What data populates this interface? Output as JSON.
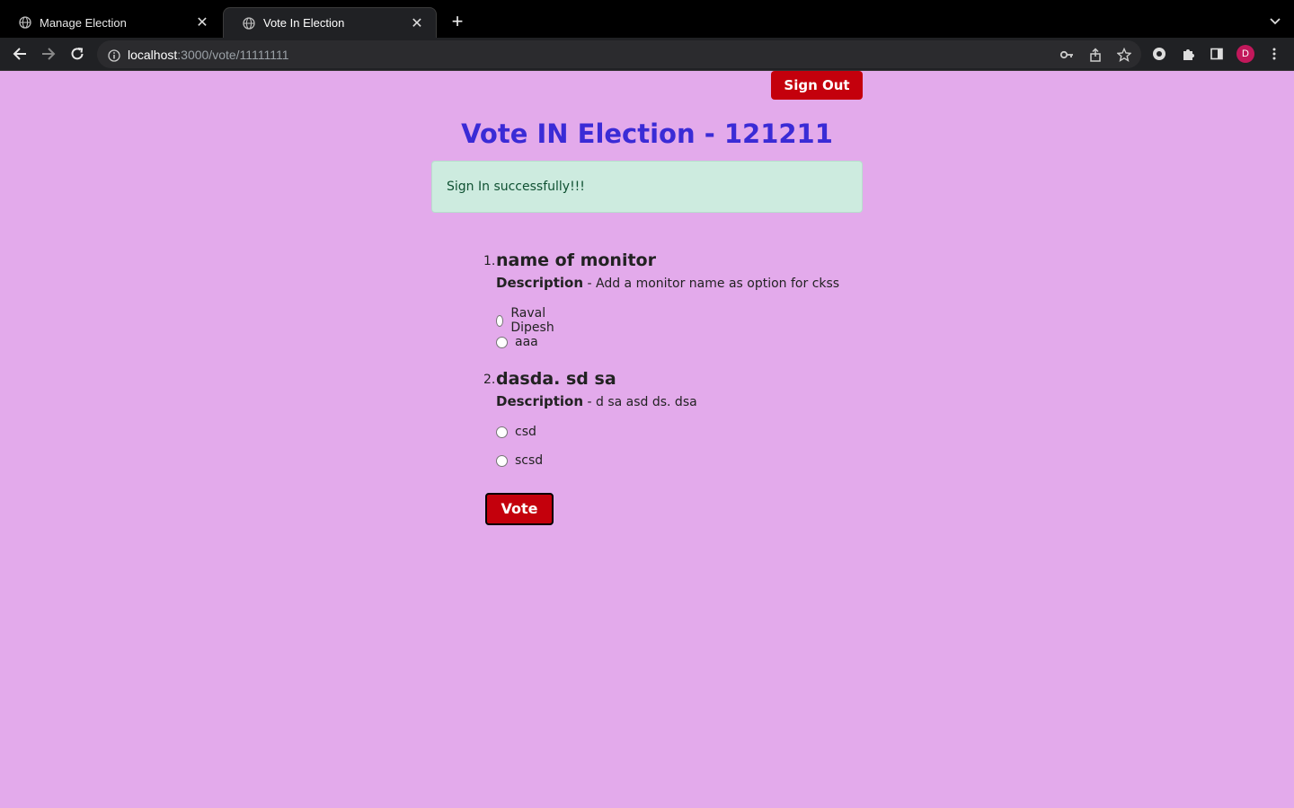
{
  "browser": {
    "tabs": [
      {
        "title": "Manage Election"
      },
      {
        "title": "Vote In Election"
      }
    ],
    "url_host": "localhost",
    "url_rest": ":3000/vote/11111111",
    "profile_initial": "D"
  },
  "page": {
    "signout_label": "Sign Out",
    "title": "Vote IN Election - 121211",
    "alert": "Sign In successfully!!!",
    "description_label": "Description",
    "questions": [
      {
        "number": "1.",
        "title": "name of monitor",
        "description": " - Add a monitor name as option for ckss",
        "options": [
          "Raval Dipesh",
          "aaa"
        ]
      },
      {
        "number": "2.",
        "title": "dasda. sd sa",
        "description": " - d sa asd ds. dsa",
        "options": [
          "csd",
          "scsd"
        ]
      }
    ],
    "vote_label": "Vote"
  },
  "colors": {
    "page_bg": "#e3aaeb",
    "title": "#3a2bd6",
    "button": "#c4000c",
    "alert_bg": "#cdebdf",
    "alert_text": "#0f5132"
  }
}
